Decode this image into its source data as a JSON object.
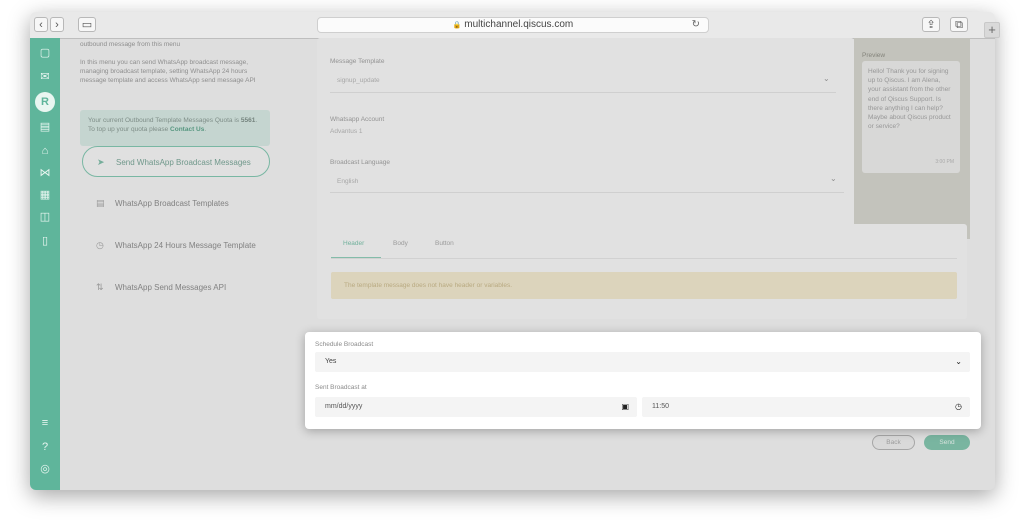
{
  "browser": {
    "url": "multichannel.qiscus.com",
    "back_label": "‹",
    "forward_label": "›",
    "sidebar_toggle_label": "▭",
    "reload_label": "↻",
    "share_label": "⇪",
    "tabs_label": "⧉",
    "new_tab_label": "+"
  },
  "icons": {
    "lock": "🔒",
    "sidebar_glyphs": [
      "▢",
      "✉",
      "R",
      "▤",
      "⌂",
      "⋈",
      "▦",
      "◫",
      "▯",
      "≡",
      "?",
      "◎"
    ]
  },
  "left_panel": {
    "intro_line1": "outbound message from this menu",
    "intro_text": "In this menu you can send WhatsApp broadcast message, managing broadcast template, setting WhatsApp 24 hours message template and access WhatsApp send message API",
    "quota_prefix": "Your current Outbound Template Messages Quota is",
    "quota_value": "5561",
    "quota_middle": ". To top up your quota please",
    "quota_link": "Contact Us",
    "quota_suffix": ".",
    "menu": [
      {
        "icon": "➤",
        "label": "Send WhatsApp Broadcast Messages"
      },
      {
        "icon": "▤",
        "label": "WhatsApp Broadcast Templates"
      },
      {
        "icon": "◷",
        "label": "WhatsApp 24 Hours Message Template"
      },
      {
        "icon": "⇅",
        "label": "WhatsApp Send Messages API"
      }
    ]
  },
  "form": {
    "template_label": "Message Template",
    "template_value": "signup_update",
    "account_label": "Whatsapp Account",
    "account_value": "Advantus 1",
    "language_label": "Broadcast Language",
    "language_value": "English",
    "chevron": "⌄"
  },
  "preview": {
    "title": "Preview",
    "message": "Hello! Thank you for signing up to Qiscus. I am Alena, your assistant from the other end of Qiscus Support. Is there anything I can help? Maybe about Qiscus product or service?",
    "time": "3:00 PM"
  },
  "tabs": {
    "header": "Header",
    "body": "Body",
    "button": "Button"
  },
  "notice": "The template message does not have header or variables.",
  "modal": {
    "schedule_label": "Schedule Broadcast",
    "schedule_value": "Yes",
    "sent_at_label": "Sent Broadcast at",
    "date_placeholder": "mm/dd/yyyy",
    "time_value": "11:50",
    "chevron": "⌄",
    "calendar_icon": "▣",
    "clock_icon": "◷"
  },
  "actions": {
    "back": "Back",
    "send": "Send"
  }
}
